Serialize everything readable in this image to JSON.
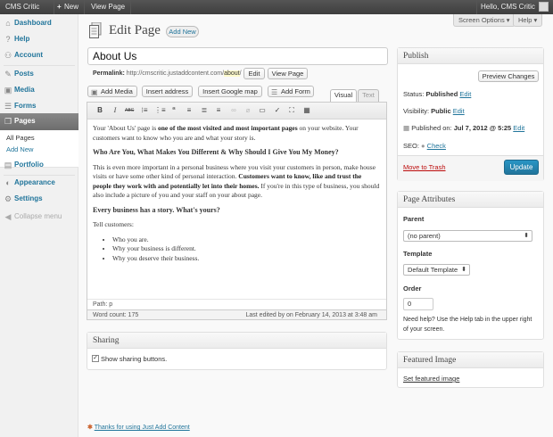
{
  "admin_bar": {
    "site_name": "CMS Critic",
    "new_label": "New",
    "view_page": "View Page",
    "greeting": "Hello, CMS Critic"
  },
  "sidebar": {
    "items": [
      {
        "label": "Dashboard",
        "icon": "dashboard-icon"
      },
      {
        "label": "Help",
        "icon": "help-icon"
      },
      {
        "label": "Account",
        "icon": "account-icon"
      },
      {
        "label": "Posts",
        "icon": "pin-icon"
      },
      {
        "label": "Media",
        "icon": "media-icon"
      },
      {
        "label": "Forms",
        "icon": "forms-icon"
      },
      {
        "label": "Pages",
        "icon": "pages-icon"
      },
      {
        "label": "Portfolio",
        "icon": "portfolio-icon"
      },
      {
        "label": "Appearance",
        "icon": "appearance-icon"
      },
      {
        "label": "Settings",
        "icon": "settings-icon"
      }
    ],
    "submenu": [
      "All Pages",
      "Add New"
    ],
    "collapse": "Collapse menu"
  },
  "top_tabs": {
    "screen_options": "Screen Options",
    "help": "Help"
  },
  "heading": {
    "title": "Edit Page",
    "add_new": "Add New"
  },
  "post_title": "About Us",
  "permalink": {
    "label": "Permalink:",
    "base": "http://cmscritic.justaddcontent.com/",
    "slug": "about",
    "trailing": "/",
    "edit": "Edit",
    "view": "View Page"
  },
  "media_buttons": [
    "Add Media",
    "Insert address",
    "Insert Google map",
    "Add Form"
  ],
  "editor_tabs": {
    "visual": "Visual",
    "text": "Text"
  },
  "toolbar_icons": [
    "bold-icon",
    "italic-icon",
    "strikethrough-icon",
    "bulleted-list-icon",
    "numbered-list-icon",
    "blockquote-icon",
    "align-left-icon",
    "align-center-icon",
    "align-right-icon",
    "link-icon",
    "unlink-icon",
    "more-tag-icon",
    "spellcheck-icon",
    "fullscreen-icon",
    "kitchen-sink-icon"
  ],
  "content": {
    "p1a": "Your 'About Us' page is ",
    "p1b": "one of the most visited and most important pages",
    "p1c": " on your website.  Your customers want to know who you are and what your story is.",
    "h1": "Who Are You, What Makes You Different & Why Should I Give You My Money?",
    "p2a": "This is even more important in a personal business where you visit your customers in person, make house visits or have some other kind of personal interaction.  ",
    "p2b": "Customers want to know, like and trust the people they work with and potentially let into their homes.",
    "p2c": " If you're in this type of business, you should also include a picture of you and your staff on your about page.",
    "h2": "Every business has a story.  What's yours?",
    "p3": "Tell customers:",
    "list": [
      "Who you are.",
      "Why your business is different.",
      "Why you deserve their business."
    ]
  },
  "path": "Path: p",
  "word_count": "Word count: 175",
  "last_edited": "Last edited by on February 14, 2013 at 3:48 am",
  "sharing": {
    "title": "Sharing",
    "checkbox_label": "Show sharing buttons.",
    "checked": true
  },
  "publish": {
    "title": "Publish",
    "preview": "Preview Changes",
    "status_label": "Status:",
    "status_value": "Published",
    "status_edit": "Edit",
    "visibility_label": "Visibility:",
    "visibility_value": "Public",
    "visibility_edit": "Edit",
    "published_label": "Published on:",
    "published_value": "Jul 7, 2012 @ 5:25",
    "published_edit": "Edit",
    "seo_label": "SEO:",
    "seo_link": "Check",
    "trash": "Move to Trash",
    "update": "Update"
  },
  "page_attributes": {
    "title": "Page Attributes",
    "parent_label": "Parent",
    "parent_value": "(no parent)",
    "template_label": "Template",
    "template_value": "Default Template",
    "order_label": "Order",
    "order_value": "0",
    "help_text_1": "Need help? Use the Help tab in the upper right",
    "help_text_2": "of your screen."
  },
  "featured_image": {
    "title": "Featured Image",
    "link": "Set featured image"
  },
  "footer": "Thanks for using Just Add Content",
  "colors": {
    "link": "#21759b",
    "update_button": "#21759b",
    "trash": "#bc0b0b",
    "admin_bar": "#464646"
  }
}
